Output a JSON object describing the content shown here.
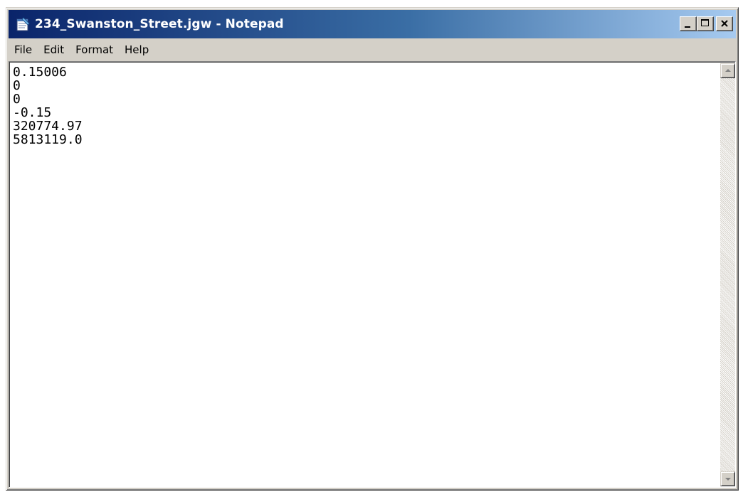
{
  "window": {
    "title": "234_Swanston_Street.jgw - Notepad",
    "app_icon": "notepad-icon"
  },
  "caption_buttons": {
    "minimize_icon": "minimize-icon",
    "maximize_icon": "maximize-icon",
    "close_icon": "close-icon"
  },
  "menu": {
    "items": [
      "File",
      "Edit",
      "Format",
      "Help"
    ]
  },
  "editor": {
    "lines": [
      "0.15006",
      "0",
      "0",
      "-0.15",
      "320774.97",
      "5813119.0"
    ]
  },
  "scrollbar": {
    "up_icon": "scroll-up-arrow-icon",
    "down_icon": "scroll-down-arrow-icon"
  },
  "colors": {
    "titlebar_start": "#0a246a",
    "titlebar_end": "#a6caf0",
    "window_face": "#d4d0c8"
  }
}
